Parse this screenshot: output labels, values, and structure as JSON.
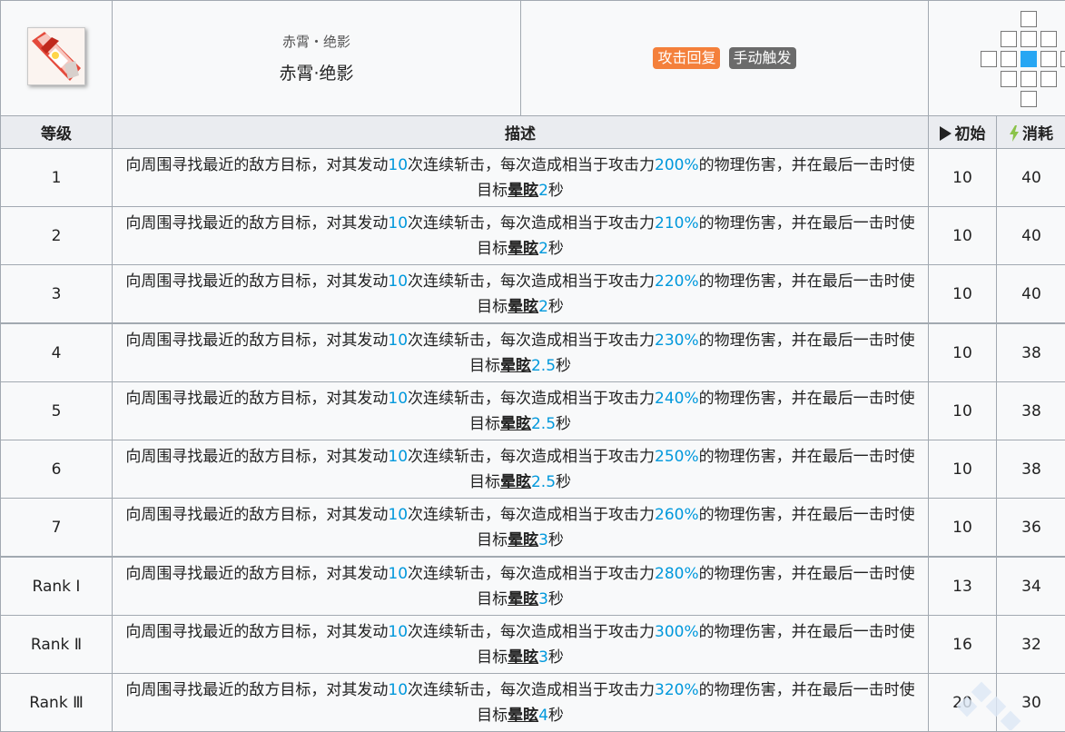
{
  "skill": {
    "name_sub": "赤霄・绝影",
    "name": "赤霄·绝影",
    "icon": "skill-icon",
    "tags": [
      "攻击回复",
      "手动触发"
    ],
    "colors": {
      "tag_attack": "#f4803b",
      "tag_manual": "#6b6b6b",
      "highlight": "#0098dc",
      "range_center": "#27a6f3"
    }
  },
  "columns": {
    "level": "等级",
    "desc": "描述",
    "init": "初始",
    "cost": "消耗"
  },
  "rows": [
    {
      "level": "1",
      "d1": "向周围寻找最近的敌方目标，对其发动",
      "hits": "10",
      "d2": "次连续斩击，每次造成相当于攻击力",
      "pct": "200%",
      "d3": "的物理伤害，并在最后一击时使目标",
      "stun": "晕眩",
      "dur": "2",
      "unit": "秒",
      "init": "10",
      "cost": "40"
    },
    {
      "level": "2",
      "d1": "向周围寻找最近的敌方目标，对其发动",
      "hits": "10",
      "d2": "次连续斩击，每次造成相当于攻击力",
      "pct": "210%",
      "d3": "的物理伤害，并在最后一击时使目标",
      "stun": "晕眩",
      "dur": "2",
      "unit": "秒",
      "init": "10",
      "cost": "40"
    },
    {
      "level": "3",
      "d1": "向周围寻找最近的敌方目标，对其发动",
      "hits": "10",
      "d2": "次连续斩击，每次造成相当于攻击力",
      "pct": "220%",
      "d3": "的物理伤害，并在最后一击时使目标",
      "stun": "晕眩",
      "dur": "2",
      "unit": "秒",
      "init": "10",
      "cost": "40"
    },
    {
      "level": "4",
      "d1": "向周围寻找最近的敌方目标，对其发动",
      "hits": "10",
      "d2": "次连续斩击，每次造成相当于攻击力",
      "pct": "230%",
      "d3": "的物理伤害，并在最后一击时使目标",
      "stun": "晕眩",
      "dur": "2.5",
      "unit": "秒",
      "init": "10",
      "cost": "38"
    },
    {
      "level": "5",
      "d1": "向周围寻找最近的敌方目标，对其发动",
      "hits": "10",
      "d2": "次连续斩击，每次造成相当于攻击力",
      "pct": "240%",
      "d3": "的物理伤害，并在最后一击时使目标",
      "stun": "晕眩",
      "dur": "2.5",
      "unit": "秒",
      "init": "10",
      "cost": "38"
    },
    {
      "level": "6",
      "d1": "向周围寻找最近的敌方目标，对其发动",
      "hits": "10",
      "d2": "次连续斩击，每次造成相当于攻击力",
      "pct": "250%",
      "d3": "的物理伤害，并在最后一击时使目标",
      "stun": "晕眩",
      "dur": "2.5",
      "unit": "秒",
      "init": "10",
      "cost": "38"
    },
    {
      "level": "7",
      "d1": "向周围寻找最近的敌方目标，对其发动",
      "hits": "10",
      "d2": "次连续斩击，每次造成相当于攻击力",
      "pct": "260%",
      "d3": "的物理伤害，并在最后一击时使目标",
      "stun": "晕眩",
      "dur": "3",
      "unit": "秒",
      "init": "10",
      "cost": "36"
    },
    {
      "level": "Rank Ⅰ",
      "d1": "向周围寻找最近的敌方目标，对其发动",
      "hits": "10",
      "d2": "次连续斩击，每次造成相当于攻击力",
      "pct": "280%",
      "d3": "的物理伤害，并在最后一击时使目标",
      "stun": "晕眩",
      "dur": "3",
      "unit": "秒",
      "init": "13",
      "cost": "34"
    },
    {
      "level": "Rank Ⅱ",
      "d1": "向周围寻找最近的敌方目标，对其发动",
      "hits": "10",
      "d2": "次连续斩击，每次造成相当于攻击力",
      "pct": "300%",
      "d3": "的物理伤害，并在最后一击时使目标",
      "stun": "晕眩",
      "dur": "3",
      "unit": "秒",
      "init": "16",
      "cost": "32"
    },
    {
      "level": "Rank Ⅲ",
      "d1": "向周围寻找最近的敌方目标，对其发动",
      "hits": "10",
      "d2": "次连续斩击，每次造成相当于攻击力",
      "pct": "320%",
      "d3": "的物理伤害，并在最后一击时使目标",
      "stun": "晕眩",
      "dur": "4",
      "unit": "秒",
      "init": "20",
      "cost": "30"
    }
  ]
}
